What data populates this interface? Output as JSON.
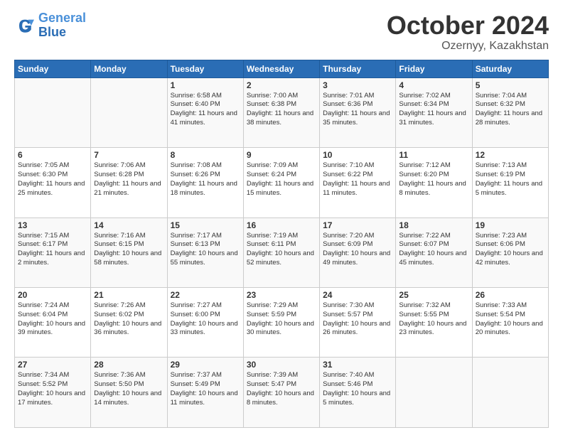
{
  "header": {
    "logo_line1": "General",
    "logo_line2": "Blue",
    "title": "October 2024",
    "subtitle": "Ozernyy, Kazakhstan"
  },
  "weekdays": [
    "Sunday",
    "Monday",
    "Tuesday",
    "Wednesday",
    "Thursday",
    "Friday",
    "Saturday"
  ],
  "weeks": [
    [
      {
        "day": "",
        "info": ""
      },
      {
        "day": "",
        "info": ""
      },
      {
        "day": "1",
        "info": "Sunrise: 6:58 AM\nSunset: 6:40 PM\nDaylight: 11 hours and 41 minutes."
      },
      {
        "day": "2",
        "info": "Sunrise: 7:00 AM\nSunset: 6:38 PM\nDaylight: 11 hours and 38 minutes."
      },
      {
        "day": "3",
        "info": "Sunrise: 7:01 AM\nSunset: 6:36 PM\nDaylight: 11 hours and 35 minutes."
      },
      {
        "day": "4",
        "info": "Sunrise: 7:02 AM\nSunset: 6:34 PM\nDaylight: 11 hours and 31 minutes."
      },
      {
        "day": "5",
        "info": "Sunrise: 7:04 AM\nSunset: 6:32 PM\nDaylight: 11 hours and 28 minutes."
      }
    ],
    [
      {
        "day": "6",
        "info": "Sunrise: 7:05 AM\nSunset: 6:30 PM\nDaylight: 11 hours and 25 minutes."
      },
      {
        "day": "7",
        "info": "Sunrise: 7:06 AM\nSunset: 6:28 PM\nDaylight: 11 hours and 21 minutes."
      },
      {
        "day": "8",
        "info": "Sunrise: 7:08 AM\nSunset: 6:26 PM\nDaylight: 11 hours and 18 minutes."
      },
      {
        "day": "9",
        "info": "Sunrise: 7:09 AM\nSunset: 6:24 PM\nDaylight: 11 hours and 15 minutes."
      },
      {
        "day": "10",
        "info": "Sunrise: 7:10 AM\nSunset: 6:22 PM\nDaylight: 11 hours and 11 minutes."
      },
      {
        "day": "11",
        "info": "Sunrise: 7:12 AM\nSunset: 6:20 PM\nDaylight: 11 hours and 8 minutes."
      },
      {
        "day": "12",
        "info": "Sunrise: 7:13 AM\nSunset: 6:19 PM\nDaylight: 11 hours and 5 minutes."
      }
    ],
    [
      {
        "day": "13",
        "info": "Sunrise: 7:15 AM\nSunset: 6:17 PM\nDaylight: 11 hours and 2 minutes."
      },
      {
        "day": "14",
        "info": "Sunrise: 7:16 AM\nSunset: 6:15 PM\nDaylight: 10 hours and 58 minutes."
      },
      {
        "day": "15",
        "info": "Sunrise: 7:17 AM\nSunset: 6:13 PM\nDaylight: 10 hours and 55 minutes."
      },
      {
        "day": "16",
        "info": "Sunrise: 7:19 AM\nSunset: 6:11 PM\nDaylight: 10 hours and 52 minutes."
      },
      {
        "day": "17",
        "info": "Sunrise: 7:20 AM\nSunset: 6:09 PM\nDaylight: 10 hours and 49 minutes."
      },
      {
        "day": "18",
        "info": "Sunrise: 7:22 AM\nSunset: 6:07 PM\nDaylight: 10 hours and 45 minutes."
      },
      {
        "day": "19",
        "info": "Sunrise: 7:23 AM\nSunset: 6:06 PM\nDaylight: 10 hours and 42 minutes."
      }
    ],
    [
      {
        "day": "20",
        "info": "Sunrise: 7:24 AM\nSunset: 6:04 PM\nDaylight: 10 hours and 39 minutes."
      },
      {
        "day": "21",
        "info": "Sunrise: 7:26 AM\nSunset: 6:02 PM\nDaylight: 10 hours and 36 minutes."
      },
      {
        "day": "22",
        "info": "Sunrise: 7:27 AM\nSunset: 6:00 PM\nDaylight: 10 hours and 33 minutes."
      },
      {
        "day": "23",
        "info": "Sunrise: 7:29 AM\nSunset: 5:59 PM\nDaylight: 10 hours and 30 minutes."
      },
      {
        "day": "24",
        "info": "Sunrise: 7:30 AM\nSunset: 5:57 PM\nDaylight: 10 hours and 26 minutes."
      },
      {
        "day": "25",
        "info": "Sunrise: 7:32 AM\nSunset: 5:55 PM\nDaylight: 10 hours and 23 minutes."
      },
      {
        "day": "26",
        "info": "Sunrise: 7:33 AM\nSunset: 5:54 PM\nDaylight: 10 hours and 20 minutes."
      }
    ],
    [
      {
        "day": "27",
        "info": "Sunrise: 7:34 AM\nSunset: 5:52 PM\nDaylight: 10 hours and 17 minutes."
      },
      {
        "day": "28",
        "info": "Sunrise: 7:36 AM\nSunset: 5:50 PM\nDaylight: 10 hours and 14 minutes."
      },
      {
        "day": "29",
        "info": "Sunrise: 7:37 AM\nSunset: 5:49 PM\nDaylight: 10 hours and 11 minutes."
      },
      {
        "day": "30",
        "info": "Sunrise: 7:39 AM\nSunset: 5:47 PM\nDaylight: 10 hours and 8 minutes."
      },
      {
        "day": "31",
        "info": "Sunrise: 7:40 AM\nSunset: 5:46 PM\nDaylight: 10 hours and 5 minutes."
      },
      {
        "day": "",
        "info": ""
      },
      {
        "day": "",
        "info": ""
      }
    ]
  ]
}
